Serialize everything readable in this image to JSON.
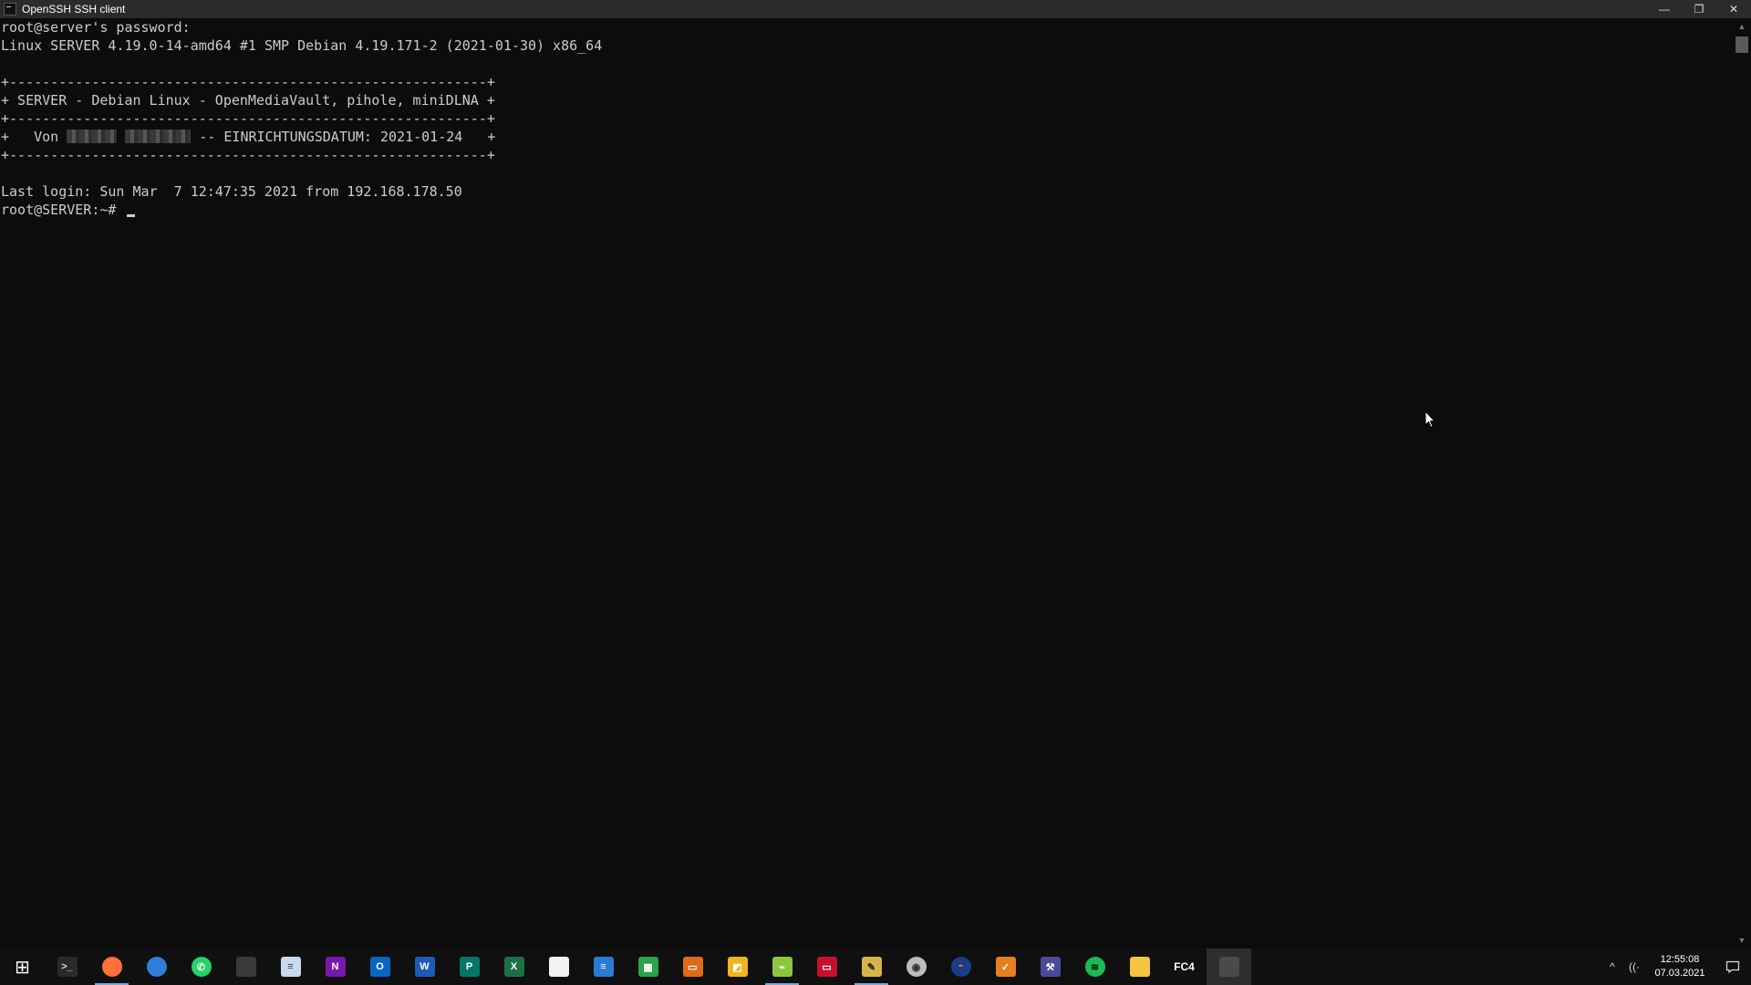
{
  "window": {
    "title": "OpenSSH SSH client",
    "controls": {
      "minimize": "—",
      "restore": "❐",
      "close": "✕"
    }
  },
  "terminal": {
    "lines": [
      "root@server's password:",
      "Linux SERVER 4.19.0-14-amd64 #1 SMP Debian 4.19.171-2 (2021-01-30) x86_64",
      "",
      "+----------------------------------------------------------+",
      "+ SERVER - Debian Linux - OpenMediaVault, pihole, miniDLNA +",
      "+----------------------------------------------------------+",
      null,
      "+----------------------------------------------------------+",
      "",
      "Last login: Sun Mar  7 12:47:35 2021 from 192.168.178.50"
    ],
    "banner_owner_line": {
      "prefix": "+   Von ",
      "suffix": " -- EINRICHTUNGSDATUM: 2021-01-24   +"
    },
    "prompt": "root@SERVER:~# "
  },
  "scrollbar": {
    "up": "▲",
    "down": "▼"
  },
  "taskbar": {
    "items": [
      {
        "name": "start-button",
        "icon": "windows-logo-icon",
        "glyph": "⊞",
        "color": "#101010",
        "text_color": "#ffffff"
      },
      {
        "name": "taskbar-terminal",
        "icon": "terminal-icon",
        "glyph": ">_",
        "color": "#2a2a2a",
        "text_color": "#dddddd"
      },
      {
        "name": "taskbar-firefox",
        "icon": "firefox-icon",
        "glyph": "",
        "color": "#ff7139",
        "text_color": "#ffffff",
        "running": true
      },
      {
        "name": "taskbar-thunderbird",
        "icon": "thunderbird-icon",
        "glyph": "",
        "color": "#2f7fd8",
        "text_color": "#ffffff"
      },
      {
        "name": "taskbar-whatsapp",
        "icon": "whatsapp-icon",
        "glyph": "✆",
        "color": "#25d366",
        "text_color": "#ffffff"
      },
      {
        "name": "taskbar-app-dark",
        "icon": "app-window-icon",
        "glyph": "",
        "color": "#3a3a3a",
        "text_color": "#ffffff"
      },
      {
        "name": "taskbar-notepad",
        "icon": "notepad-icon",
        "glyph": "≡",
        "color": "#c9d9ee",
        "text_color": "#335"
      },
      {
        "name": "taskbar-onenote",
        "icon": "onenote-icon",
        "glyph": "N",
        "color": "#7719aa",
        "text_color": "#ffffff"
      },
      {
        "name": "taskbar-outlook",
        "icon": "outlook-icon",
        "glyph": "O",
        "color": "#0a64c4",
        "text_color": "#ffffff"
      },
      {
        "name": "taskbar-word",
        "icon": "word-icon",
        "glyph": "W",
        "color": "#1f5bb5",
        "text_color": "#ffffff"
      },
      {
        "name": "taskbar-publisher",
        "icon": "publisher-icon",
        "glyph": "P",
        "color": "#077568",
        "text_color": "#ffffff"
      },
      {
        "name": "taskbar-excel",
        "icon": "excel-icon",
        "glyph": "X",
        "color": "#1d7044",
        "text_color": "#ffffff"
      },
      {
        "name": "taskbar-blank-doc",
        "icon": "document-icon",
        "glyph": "",
        "color": "#f2f2f2",
        "text_color": "#333"
      },
      {
        "name": "taskbar-writer",
        "icon": "writer-icon",
        "glyph": "≡",
        "color": "#2a7bd4",
        "text_color": "#ffffff"
      },
      {
        "name": "taskbar-calc",
        "icon": "calc-icon",
        "glyph": "▦",
        "color": "#2aa34a",
        "text_color": "#ffffff"
      },
      {
        "name": "taskbar-impress",
        "icon": "impress-icon",
        "glyph": "▭",
        "color": "#e06a1b",
        "text_color": "#ffffff"
      },
      {
        "name": "taskbar-draw",
        "icon": "draw-icon",
        "glyph": "◩",
        "color": "#f0b51c",
        "text_color": "#ffffff"
      },
      {
        "name": "taskbar-chart-app",
        "icon": "chart-app-icon",
        "glyph": "⌁",
        "color": "#8cc63f",
        "text_color": "#ffffff",
        "running": true
      },
      {
        "name": "taskbar-red-terminal",
        "icon": "red-terminal-icon",
        "glyph": "▭",
        "color": "#c8102e",
        "text_color": "#ffffff"
      },
      {
        "name": "taskbar-pen-tool",
        "icon": "pen-tool-icon",
        "glyph": "✎",
        "color": "#d8b24a",
        "text_color": "#222",
        "running": true
      },
      {
        "name": "taskbar-shield",
        "icon": "shield-icon",
        "glyph": "◉",
        "color": "#bdbdbd",
        "text_color": "#333"
      },
      {
        "name": "taskbar-sun-app",
        "icon": "sun-icon",
        "glyph": "◓",
        "color": "#1a3c8a",
        "text_color": "#ff6a00"
      },
      {
        "name": "taskbar-check-tool",
        "icon": "check-tool-icon",
        "glyph": "✓",
        "color": "#e67e22",
        "text_color": "#ffffff"
      },
      {
        "name": "taskbar-tools",
        "icon": "tools-icon",
        "glyph": "⚒",
        "color": "#4a4a9a",
        "text_color": "#ffffff"
      },
      {
        "name": "taskbar-spotify",
        "icon": "spotify-icon",
        "glyph": "≋",
        "color": "#1db954",
        "text_color": "#111"
      },
      {
        "name": "taskbar-explorer",
        "icon": "folder-icon",
        "glyph": "",
        "color": "#f4c542",
        "text_color": "#ffffff"
      },
      {
        "name": "taskbar-fc4",
        "icon": "fc4-icon",
        "glyph": "FC4",
        "color": "#101010",
        "text_color": "#ffffff"
      },
      {
        "name": "taskbar-ssh-client",
        "icon": "ssh-window-icon",
        "glyph": "",
        "color": "#4a4a4a",
        "text_color": "#ffffff",
        "active": true
      }
    ],
    "tray": {
      "chevron": "^",
      "network": "((·",
      "time": "12:55:08",
      "date": "07.03.2021"
    }
  }
}
